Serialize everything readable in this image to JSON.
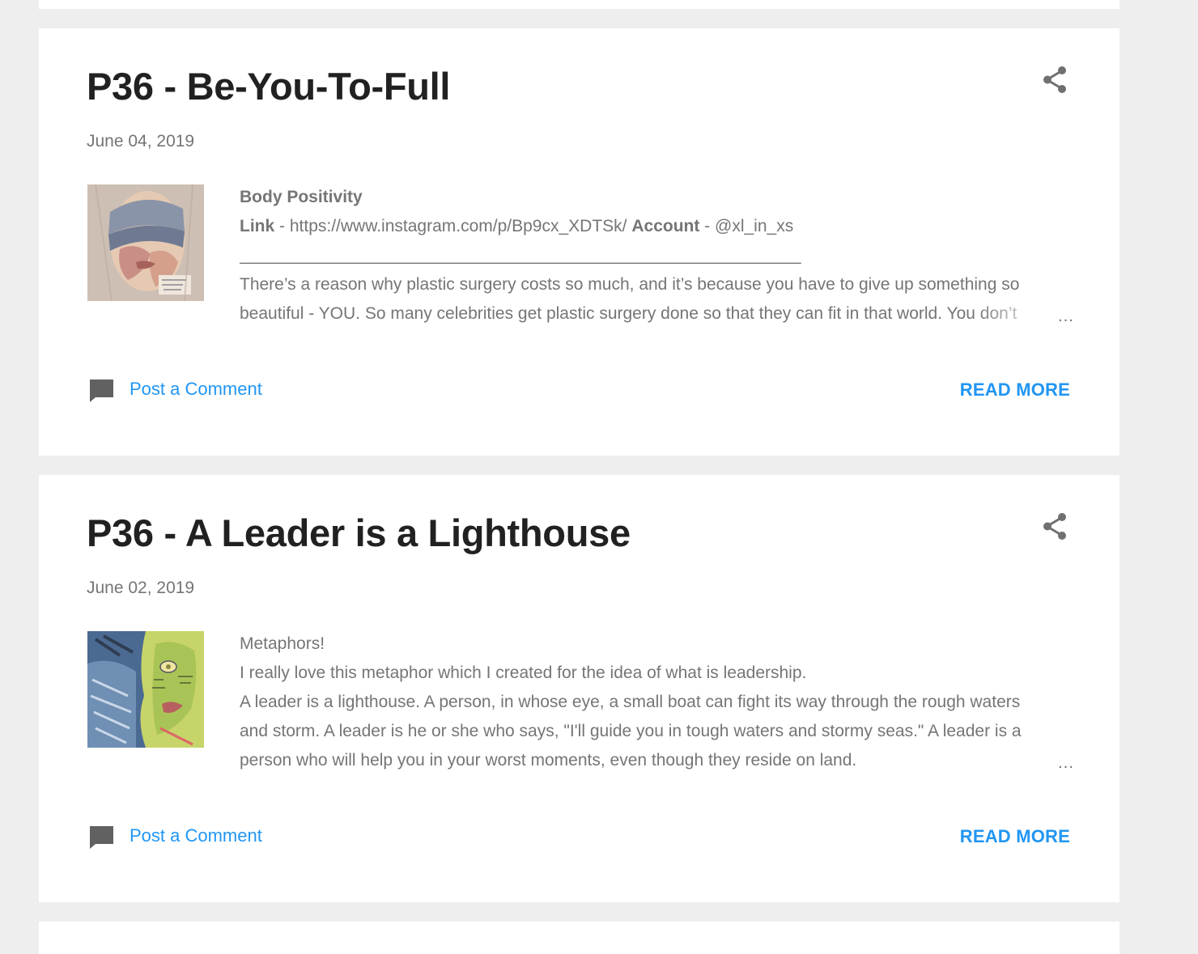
{
  "posts": [
    {
      "title": "P36 - Be-You-To-Full",
      "date": "June 04, 2019",
      "snippet": {
        "heading": "Body Positivity",
        "link_label": "Link",
        "link_sep": " - ",
        "link_url": "https://www.instagram.com/p/Bp9cx_XDTSk/",
        "account_label": "Account",
        "account_sep": " - ",
        "account_handle": "@xl_in_xs",
        "rule": "______________________________________________________________",
        "lines": [
          "There’s a reason why plastic surgery costs so much, and it’s because you have to give up something so",
          "beautiful - YOU. So many celebrities get plastic surgery done so that they can fit in that world. You don’t"
        ]
      },
      "ellipsis": "…",
      "comment_label": "Post a Comment",
      "read_more_label": "READ MORE",
      "share_icon": "share-icon",
      "comment_icon": "comment-icon"
    },
    {
      "title": "P36 - A Leader is a Lighthouse",
      "date": "June 02, 2019",
      "snippet": {
        "lines": [
          "Metaphors!",
          "I really love this metaphor which I created for the idea of what is leadership.",
          "A leader is a lighthouse. A person, in whose eye, a small boat can fight its way through the rough waters",
          "and storm. A leader is he or she who says, \"I'll guide you in tough waters and stormy seas.\" A leader is a",
          "person who will help you in your worst moments, even though they reside on land."
        ]
      },
      "ellipsis": "…",
      "comment_label": "Post a Comment",
      "read_more_label": "READ MORE",
      "share_icon": "share-icon",
      "comment_icon": "comment-icon"
    }
  ],
  "colors": {
    "page_background": "#eeeeee",
    "card_background": "#ffffff",
    "title_text": "#212121",
    "body_text": "#757575",
    "link_accent": "#2196f3",
    "icon_grey": "#707070"
  }
}
